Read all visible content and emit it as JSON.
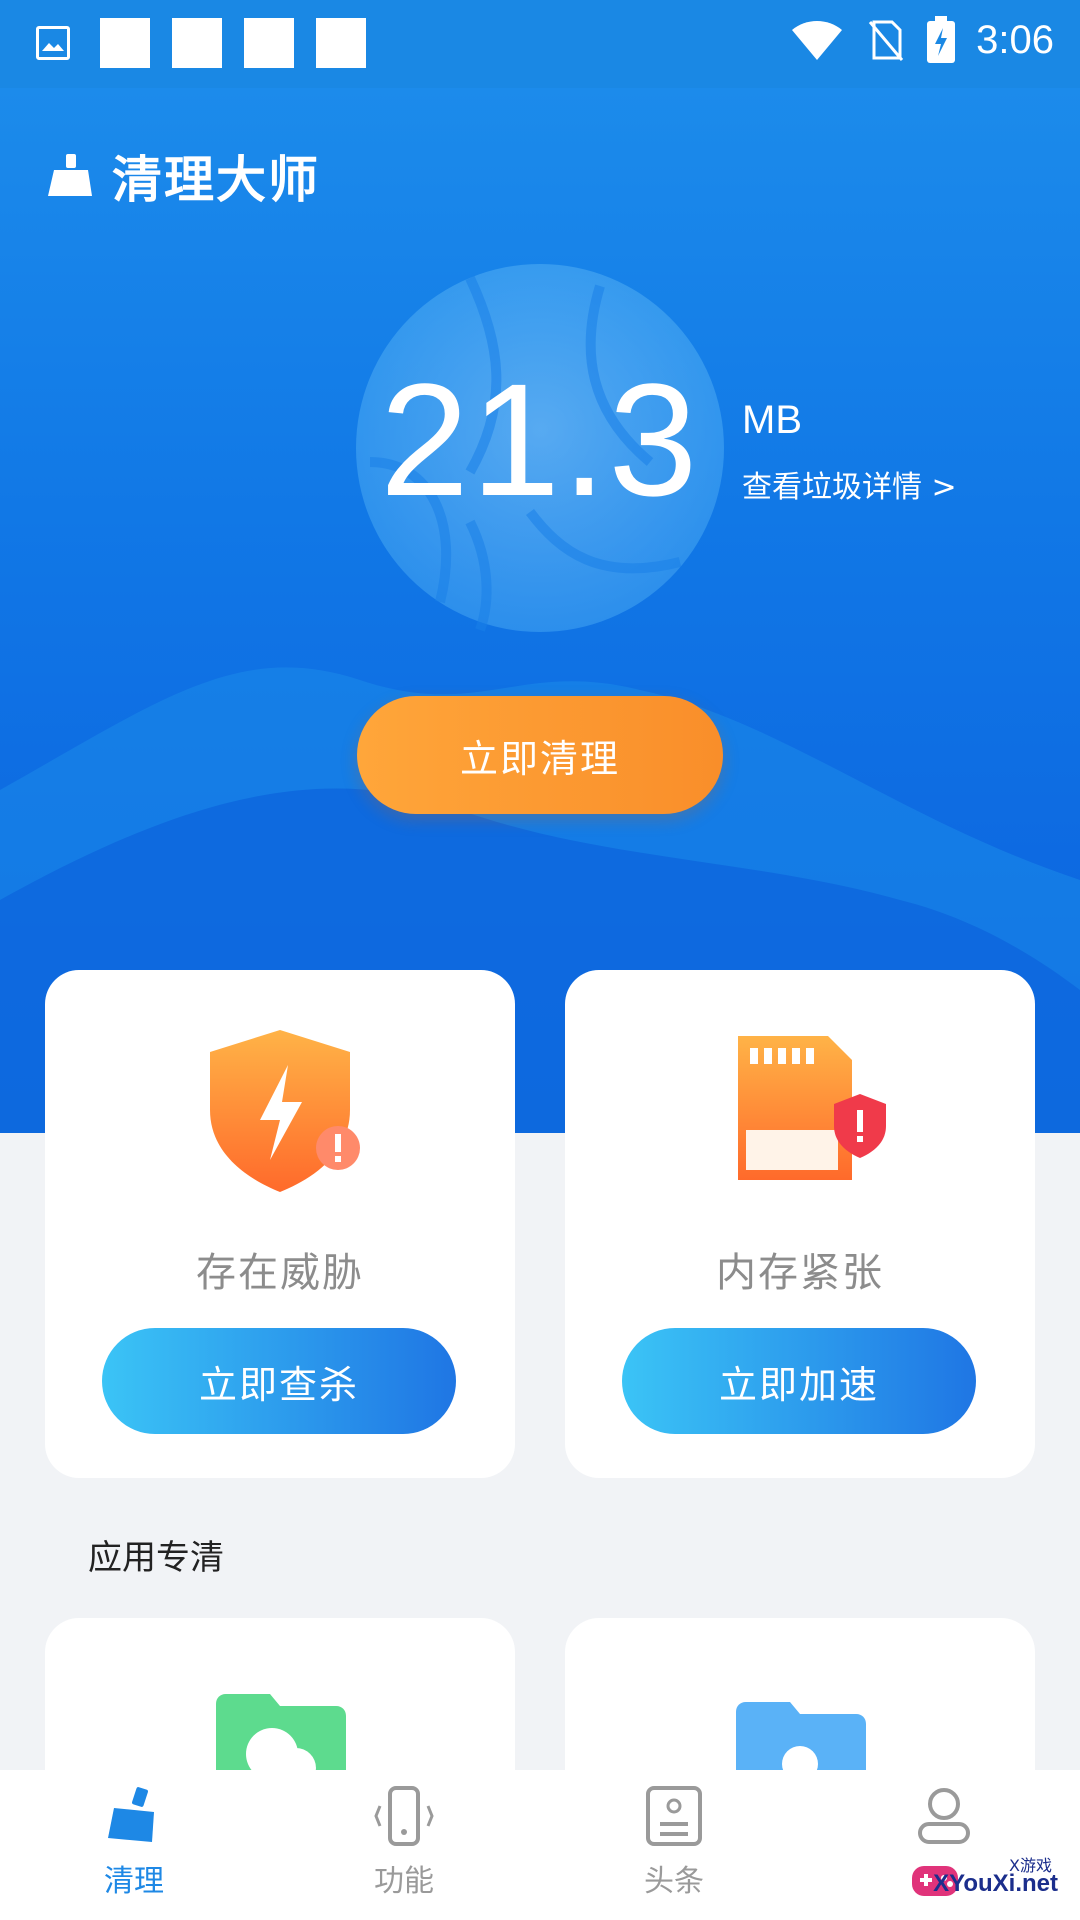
{
  "status_bar": {
    "time": "3:06"
  },
  "app": {
    "title": "清理大师"
  },
  "junk": {
    "value": "21.3",
    "unit": "MB",
    "detail_link": "查看垃圾详情 >"
  },
  "clean_button": "立即清理",
  "cards": [
    {
      "label": "存在威胁",
      "button": "立即查杀"
    },
    {
      "label": "内存紧张",
      "button": "立即加速"
    }
  ],
  "section": {
    "title": "应用专清"
  },
  "tabs": [
    {
      "label": "清理",
      "active": true
    },
    {
      "label": "功能",
      "active": false
    },
    {
      "label": "头条",
      "active": false
    }
  ],
  "watermark": {
    "text": "XYouXi.net",
    "small": "X游戏"
  },
  "colors": {
    "hero_blue": "#1178E6",
    "accent_orange": "#F98E2A",
    "button_blue": "#1F76E4",
    "active_tab": "#1E88E5"
  }
}
